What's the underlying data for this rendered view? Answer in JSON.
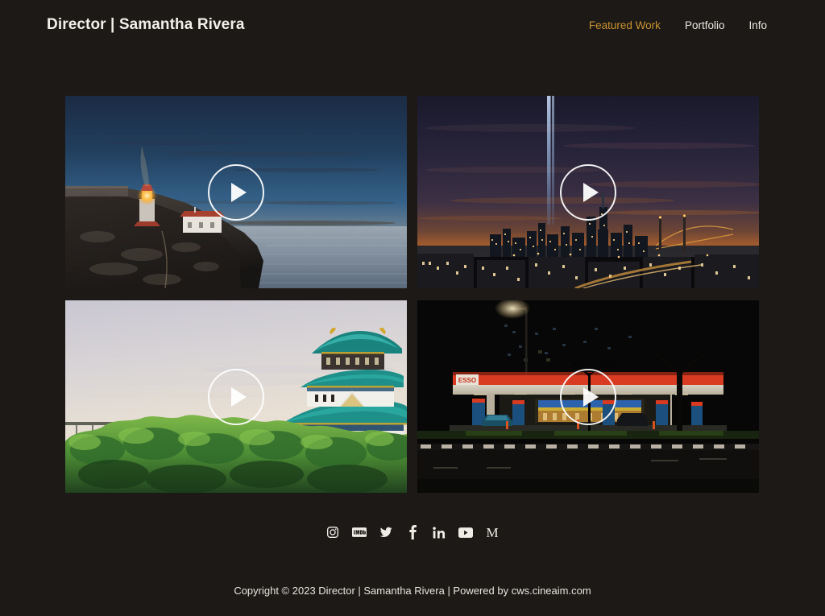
{
  "site": {
    "background_color": "#1d1917",
    "accent_color": "#c8932f",
    "text_color": "#efece5"
  },
  "header": {
    "brand": "Director | Samantha Rivera",
    "nav": [
      {
        "label": "Featured Work",
        "active": true
      },
      {
        "label": "Portfolio",
        "active": false
      },
      {
        "label": "Info",
        "active": false
      }
    ]
  },
  "gallery": {
    "play_icon": "play-icon",
    "items": [
      {
        "id": "video-1",
        "scene": "lighthouse-on-cliff-at-dusk",
        "play_label": "Play"
      },
      {
        "id": "video-2",
        "scene": "city-skyline-night-tribute-lights",
        "play_label": "Play"
      },
      {
        "id": "video-3",
        "scene": "japanese-castle-over-treetops",
        "play_label": "Play"
      },
      {
        "id": "video-4",
        "scene": "esso-gas-station-at-night",
        "station_sign": "ESSO",
        "play_label": "Play"
      }
    ]
  },
  "footer": {
    "socials": [
      {
        "name": "instagram-icon",
        "label": "Instagram"
      },
      {
        "name": "imdb-icon",
        "label": "IMDb"
      },
      {
        "name": "twitter-icon",
        "label": "Twitter"
      },
      {
        "name": "facebook-icon",
        "label": "Facebook"
      },
      {
        "name": "linkedin-icon",
        "label": "LinkedIn"
      },
      {
        "name": "youtube-icon",
        "label": "YouTube"
      },
      {
        "name": "medium-icon",
        "label": "M"
      }
    ],
    "copyright": "Copyright © 2023 Director | Samantha Rivera | Powered by cws.cineaim.com"
  }
}
